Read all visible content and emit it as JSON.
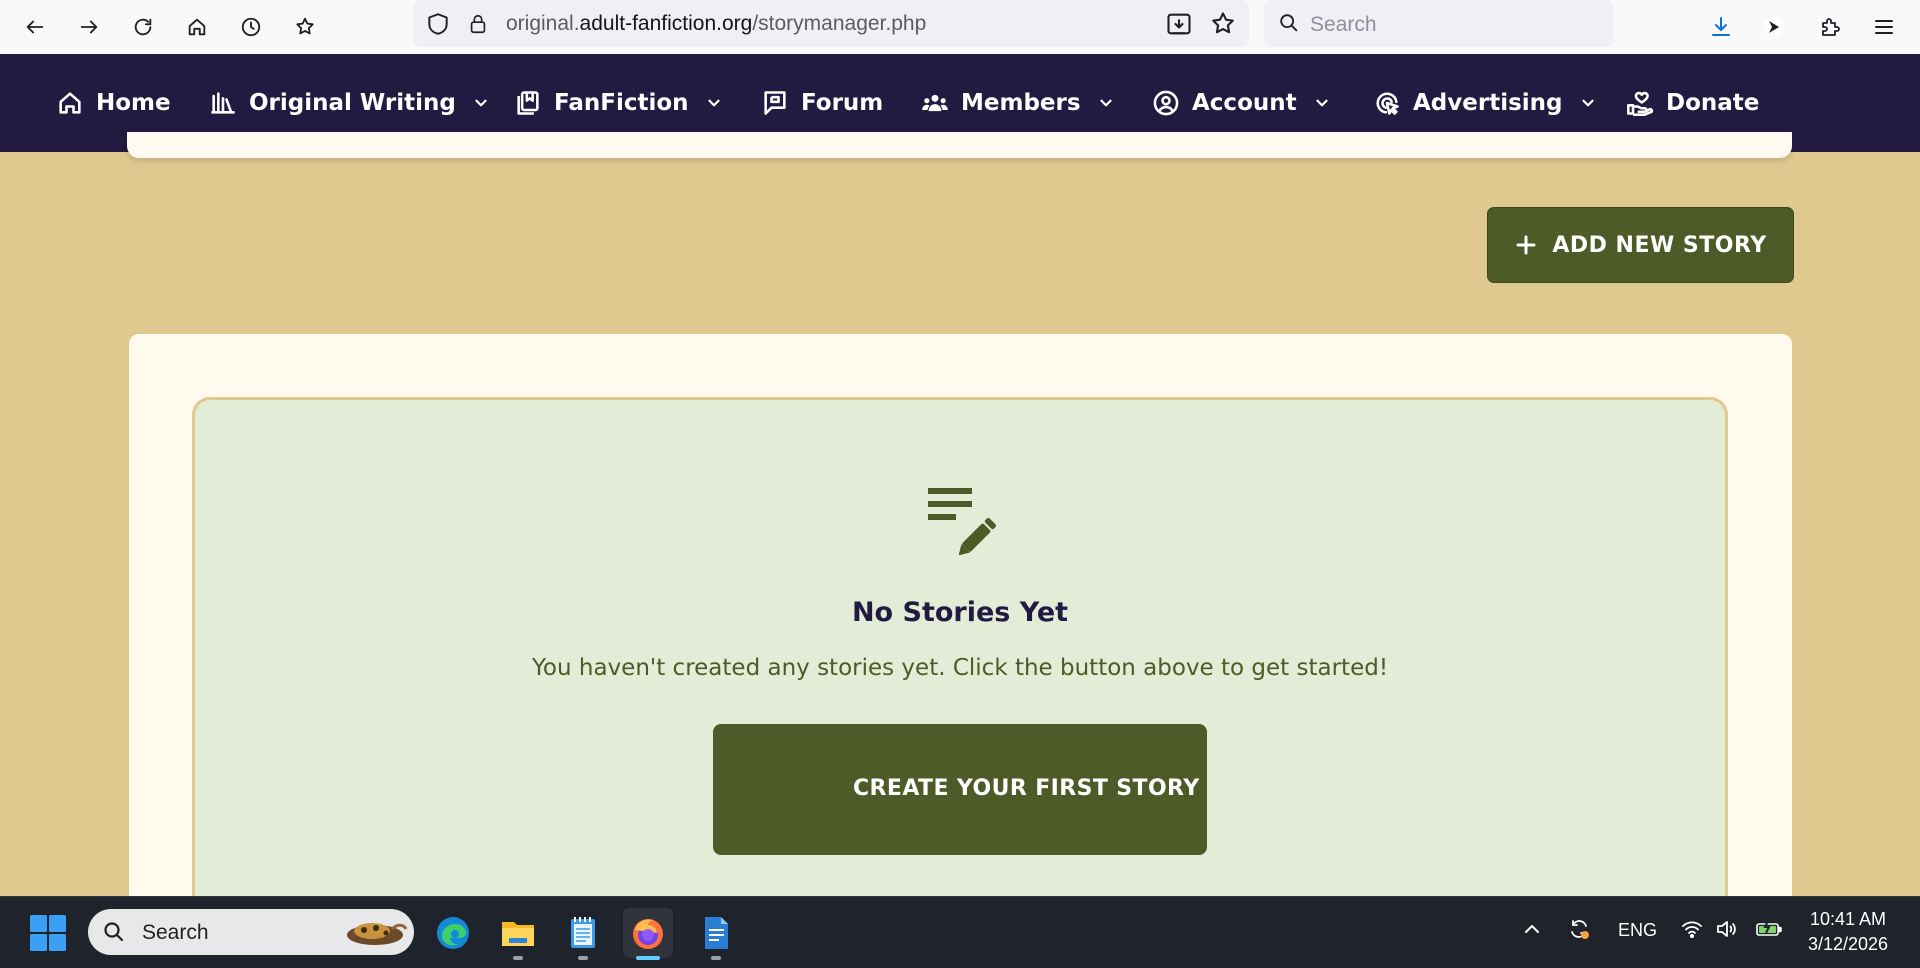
{
  "browser": {
    "url_prefix": "original.",
    "url_domain": "adult-fanfiction.org",
    "url_path": "/storymanager.php",
    "search_placeholder": "Search"
  },
  "nav": {
    "items": [
      {
        "label": "Home",
        "icon": "home-icon",
        "dropdown": false
      },
      {
        "label": "Original Writing",
        "icon": "books-icon",
        "dropdown": true
      },
      {
        "label": "FanFiction",
        "icon": "library-icon",
        "dropdown": true
      },
      {
        "label": "Forum",
        "icon": "forum-icon",
        "dropdown": false
      },
      {
        "label": "Members",
        "icon": "members-icon",
        "dropdown": true
      },
      {
        "label": "Account",
        "icon": "account-icon",
        "dropdown": true
      },
      {
        "label": "Advertising",
        "icon": "advertising-icon",
        "dropdown": true
      },
      {
        "label": "Donate",
        "icon": "donate-icon",
        "dropdown": false
      }
    ]
  },
  "actions": {
    "add_story": "ADD NEW STORY"
  },
  "empty_state": {
    "title": "No Stories Yet",
    "message": "You haven't created any stories yet. Click the button above to get started!",
    "button": "CREATE YOUR FIRST STORY"
  },
  "taskbar": {
    "search_placeholder": "Search",
    "language": "ENG",
    "time": "10:41 AM",
    "date": "3/12/2026"
  },
  "colors": {
    "nav_bg": "#231a42",
    "page_bg": "#e0c98f",
    "button_green": "#4c5b27",
    "empty_bg": "#e2ecd6",
    "card_bg": "#fffaee"
  }
}
